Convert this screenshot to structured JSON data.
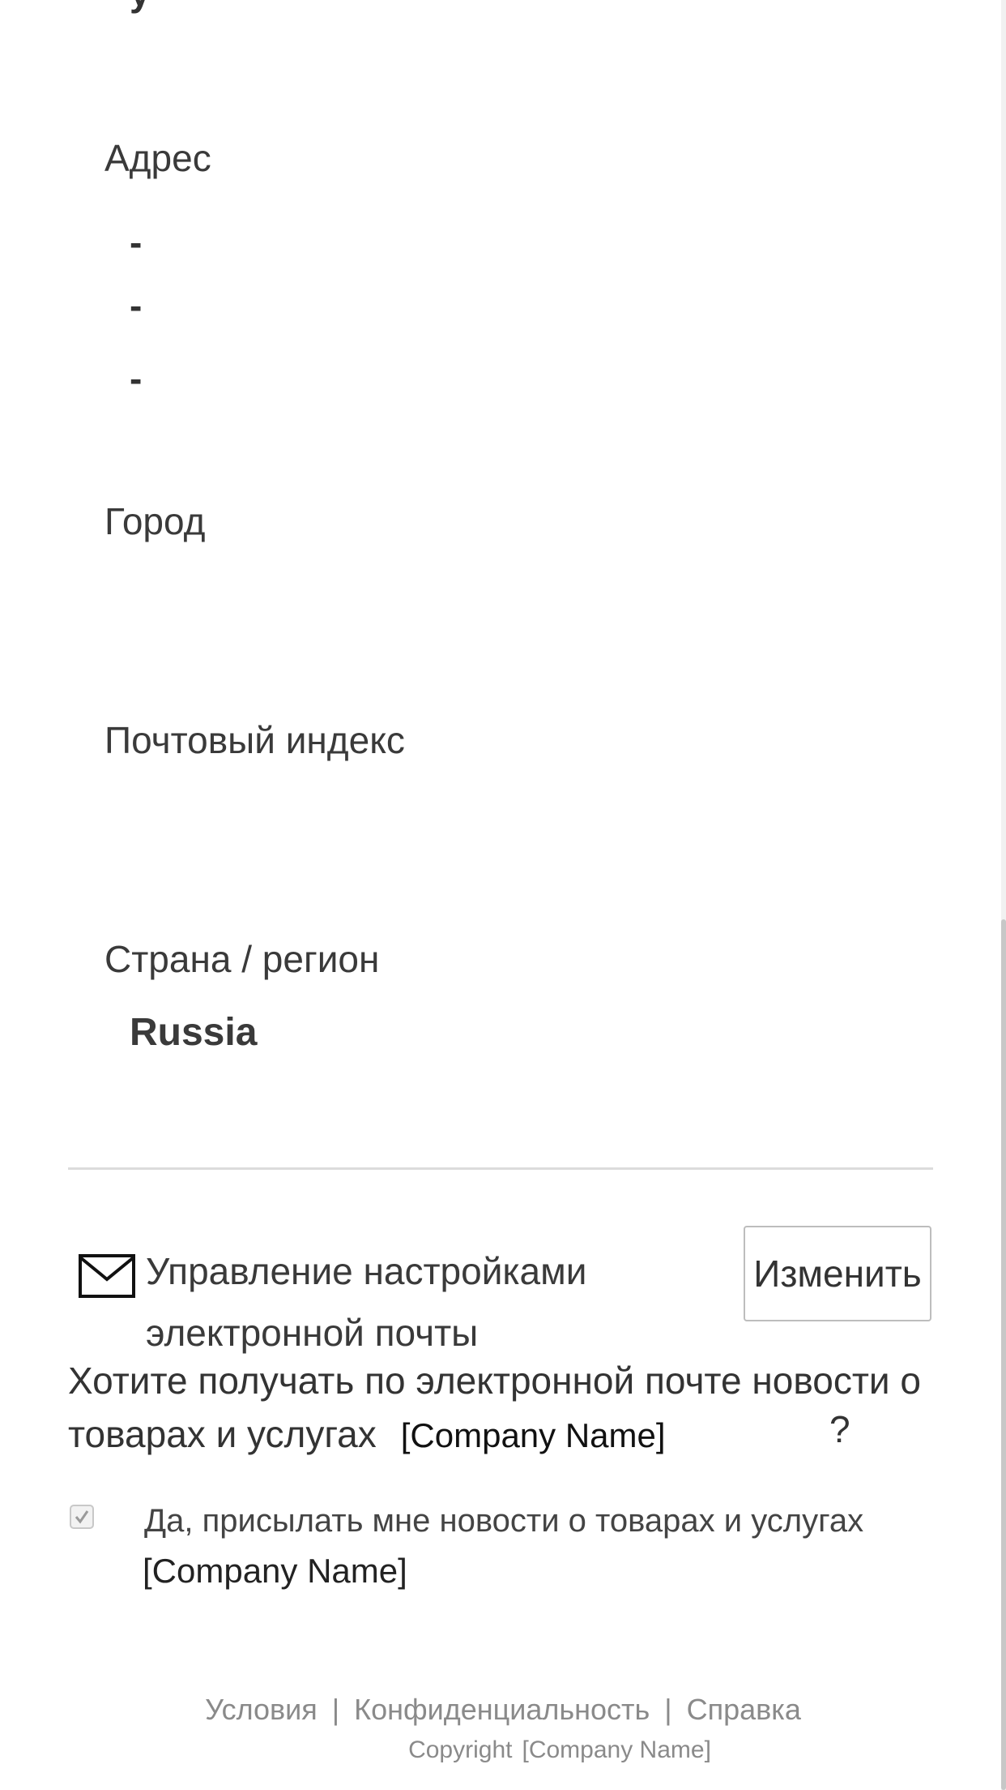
{
  "address": {
    "label": "Адрес",
    "lines": [
      "-",
      "-",
      "-"
    ]
  },
  "city": {
    "label": "Город",
    "value": ""
  },
  "postal_code": {
    "label": "Почтовый индекс",
    "value": ""
  },
  "country": {
    "label": "Страна / регион",
    "value": "Russia"
  },
  "email_prefs": {
    "icon": "envelope-icon",
    "title_line1": "Управление настройками",
    "title_line2": "электронной почты",
    "change_button": "Изменить"
  },
  "newsletter": {
    "question_part1": "Хотите получать по электронной почте новости о товарах и услугах",
    "company": "[Company Name]",
    "question_mark": "?",
    "checkbox_checked": true,
    "consent_text": "Да, присылать мне новости о товарах и услугах",
    "consent_company": "[Company Name]"
  },
  "footer": {
    "links": [
      "Условия",
      "Конфиденциальность",
      "Справка"
    ],
    "separator": "|",
    "copyright_label": "Copyright",
    "copyright_company": "[Company Name]"
  },
  "clipped_top_text": "y"
}
